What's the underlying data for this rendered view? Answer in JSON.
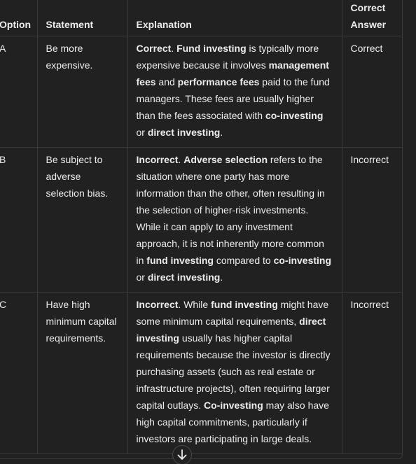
{
  "table": {
    "headers": {
      "option": "Option",
      "statement": "Statement",
      "explanation": "Explanation",
      "answer_line1": "Correct",
      "answer_line2": "Answer"
    },
    "rows": [
      {
        "option": "A",
        "statement": "Be more expensive.",
        "explanation": [
          {
            "t": "Correct",
            "b": true
          },
          {
            "t": ". ",
            "b": false
          },
          {
            "t": "Fund investing",
            "b": true
          },
          {
            "t": " is typically more expensive because it involves ",
            "b": false
          },
          {
            "t": "management fees",
            "b": true
          },
          {
            "t": " and ",
            "b": false
          },
          {
            "t": "performance fees",
            "b": true
          },
          {
            "t": " paid to the fund managers. These fees are usually higher than the fees associated with ",
            "b": false
          },
          {
            "t": "co-investing",
            "b": true
          },
          {
            "t": " or ",
            "b": false
          },
          {
            "t": "direct investing",
            "b": true
          },
          {
            "t": ".",
            "b": false
          }
        ],
        "answer": "Correct"
      },
      {
        "option": "B",
        "statement": "Be subject to adverse selection bias.",
        "explanation": [
          {
            "t": "Incorrect",
            "b": true
          },
          {
            "t": ". ",
            "b": false
          },
          {
            "t": "Adverse selection",
            "b": true
          },
          {
            "t": " refers to the situation where one party has more information than the other, often resulting in the selection of higher-risk investments. While it can apply to any investment approach, it is not inherently more common in ",
            "b": false
          },
          {
            "t": "fund investing",
            "b": true
          },
          {
            "t": " compared to ",
            "b": false
          },
          {
            "t": "co-investing",
            "b": true
          },
          {
            "t": " or ",
            "b": false
          },
          {
            "t": "direct investing",
            "b": true
          },
          {
            "t": ".",
            "b": false
          }
        ],
        "answer": "Incorrect"
      },
      {
        "option": "C",
        "statement": "Have high minimum capital requirements.",
        "explanation": [
          {
            "t": "Incorrect",
            "b": true
          },
          {
            "t": ". While ",
            "b": false
          },
          {
            "t": "fund investing",
            "b": true
          },
          {
            "t": " might have some minimum capital requirements, ",
            "b": false
          },
          {
            "t": "direct investing",
            "b": true
          },
          {
            "t": " usually has higher capital requirements because the investor is directly purchasing assets (such as real estate or infrastructure projects), often requiring larger capital outlays. ",
            "b": false
          },
          {
            "t": "Co-investing",
            "b": true
          },
          {
            "t": " may also have high capital commitments, particularly if investors are participating in large deals.",
            "b": false
          }
        ],
        "answer": "Incorrect"
      }
    ]
  },
  "scroll_button": {
    "icon": "arrow-down-icon"
  },
  "colors": {
    "background": "#212121",
    "text": "#ececec",
    "border": "#3a3a3a"
  }
}
